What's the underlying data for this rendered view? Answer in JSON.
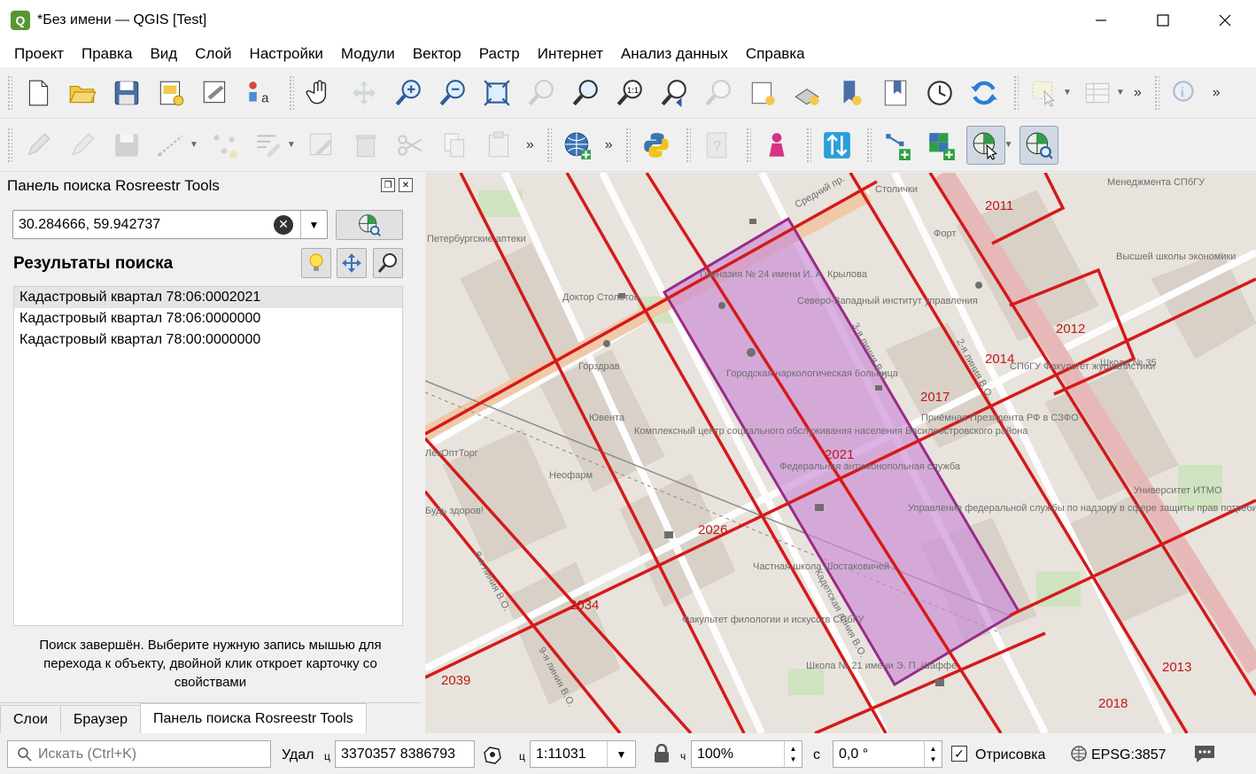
{
  "window": {
    "title": "*Без имени — QGIS [Test]",
    "app_icon": "qgis-icon",
    "controls": [
      "minimize-icon",
      "maximize-icon",
      "close-icon"
    ]
  },
  "menu": [
    "Проект",
    "Правка",
    "Вид",
    "Слой",
    "Настройки",
    "Модули",
    "Вектор",
    "Растр",
    "Интернет",
    "Анализ данных",
    "Справка"
  ],
  "panel": {
    "title": "Панель поиска Rosreestr Tools",
    "search_value": "30.284666, 59.942737",
    "results_title": "Результаты поиска",
    "results": [
      "Кадастровый квартал 78:06:0002021",
      "Кадастровый квартал 78:06:0000000",
      "Кадастровый квартал 78:00:0000000"
    ],
    "status": "Поиск завершён. Выберите нужную запись мышью для перехода к объекту, двойной клик откроет карточку со свойствами",
    "tabs": [
      "Слои",
      "Браузер",
      "Панель поиска Rosreestr Tools"
    ]
  },
  "map": {
    "quarter_labels": [
      "2011",
      "2012",
      "2014",
      "2017",
      "2021",
      "2026",
      "2034",
      "2039",
      "2013",
      "2018"
    ],
    "street_labels": [
      "Средний пр.",
      "Столички",
      "Петербургские аптеки",
      "Гимназия № 24 имени И. А. Крылова",
      "Северо-Западный институт управления",
      "Доктор Столетов",
      "Горздрав",
      "Городская наркологическая больница",
      "Ювента",
      "Комплексный центр социального обслуживания населения Василеостровского района",
      "Неофарм",
      "Федеральная антимонопольная служба",
      "Приёмная Президента РФ в СЗФО",
      "Управление федеральной службы по надзору в сфере защиты прав потребителей",
      "Частная школа Шостаковичей",
      "Факультет филологии и искусств СПбГУ",
      "Школа № 21 имени Э. П. Шаффе",
      "Университет ИТМО",
      "Будь здоров!",
      "ЛекОптТорг",
      "Форт",
      "СПбГУ Факультет журналистики",
      "Школа № 35",
      "8-я линия В.О.",
      "9-я линия В.О.",
      "3-я линия В.О.",
      "2-я линия В.О.",
      "Кадетская линия В.О.",
      "Менеджмента СПбГУ",
      "Высшей школы экономики"
    ],
    "highlight_color": "#c98ad6",
    "boundary_color": "#d51a1a"
  },
  "statusbar": {
    "locator_placeholder": "Искать (Ctrl+K)",
    "coord_label": "Удал",
    "coord_prefix": "ц",
    "coordinate": "3370357  8386793",
    "scale_label": "ц",
    "scale": "1:11031",
    "magnifier_label": "ч",
    "magnifier": "100%",
    "rotation_label": "с",
    "rotation": "0,0 °",
    "render_label": "Отрисовка",
    "render_checked": "✓",
    "crs": "EPSG:3857"
  }
}
